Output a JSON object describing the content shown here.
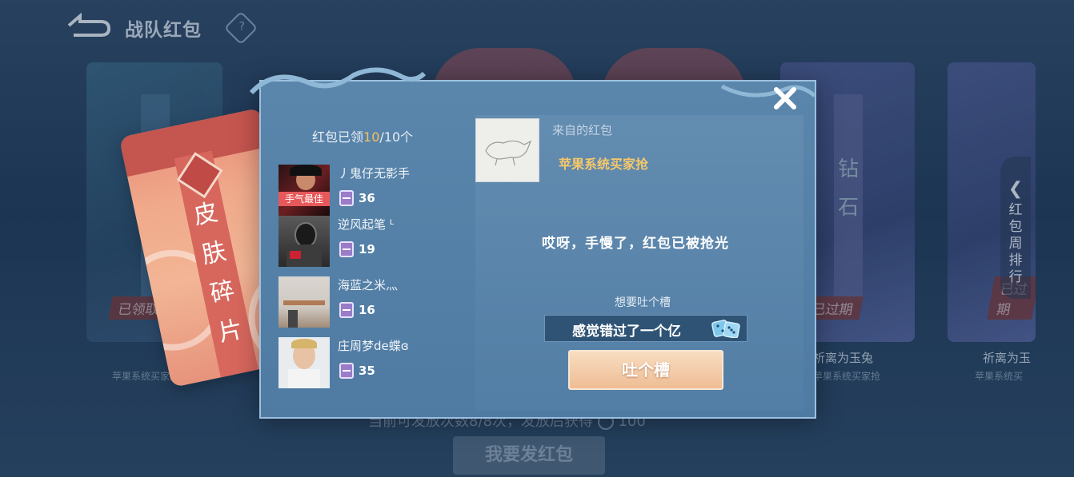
{
  "background": {
    "title": "战队红包",
    "captions": [
      "苹果系统买家抢",
      "祈离为玉兔",
      "祈离为玉",
      "苹果系统买家抢",
      "苹果系统买"
    ],
    "badges": [
      "已领取",
      "已过期",
      "已过期"
    ],
    "card_vertical_texts": [
      "碎片",
      "钻石"
    ],
    "weekly_rank_label": "红包周排行",
    "send_count_text": "当前可发放次数8/8次，发放后获得",
    "send_reward": "100",
    "send_button": "我要发红包"
  },
  "envelope": {
    "text": "皮肤碎片"
  },
  "modal": {
    "claimed_prefix": "红包已领",
    "claimed_count": "10",
    "claimed_suffix": "/10个",
    "claimers": [
      {
        "name": "丿鬼仔无影手",
        "amount": "36",
        "tag": "手气最佳"
      },
      {
        "name": "逆风起笔 ᒻ",
        "amount": "19"
      },
      {
        "name": "海蓝之米灬",
        "amount": "16"
      },
      {
        "name": "庄周梦de蝶ɞ",
        "amount": "35"
      }
    ],
    "from_label": "来自的红包",
    "from_name": "苹果系统买家抢",
    "empty_message": "哎呀，手慢了，红包已被抢光",
    "complain_label": "想要吐个槽",
    "complain_value": "感觉错过了一个亿",
    "complain_button": "吐个槽"
  },
  "colors": {
    "highlight": "#f5c05d",
    "modal_bg": "#5a86ac",
    "best_tag": "#e7585a"
  }
}
